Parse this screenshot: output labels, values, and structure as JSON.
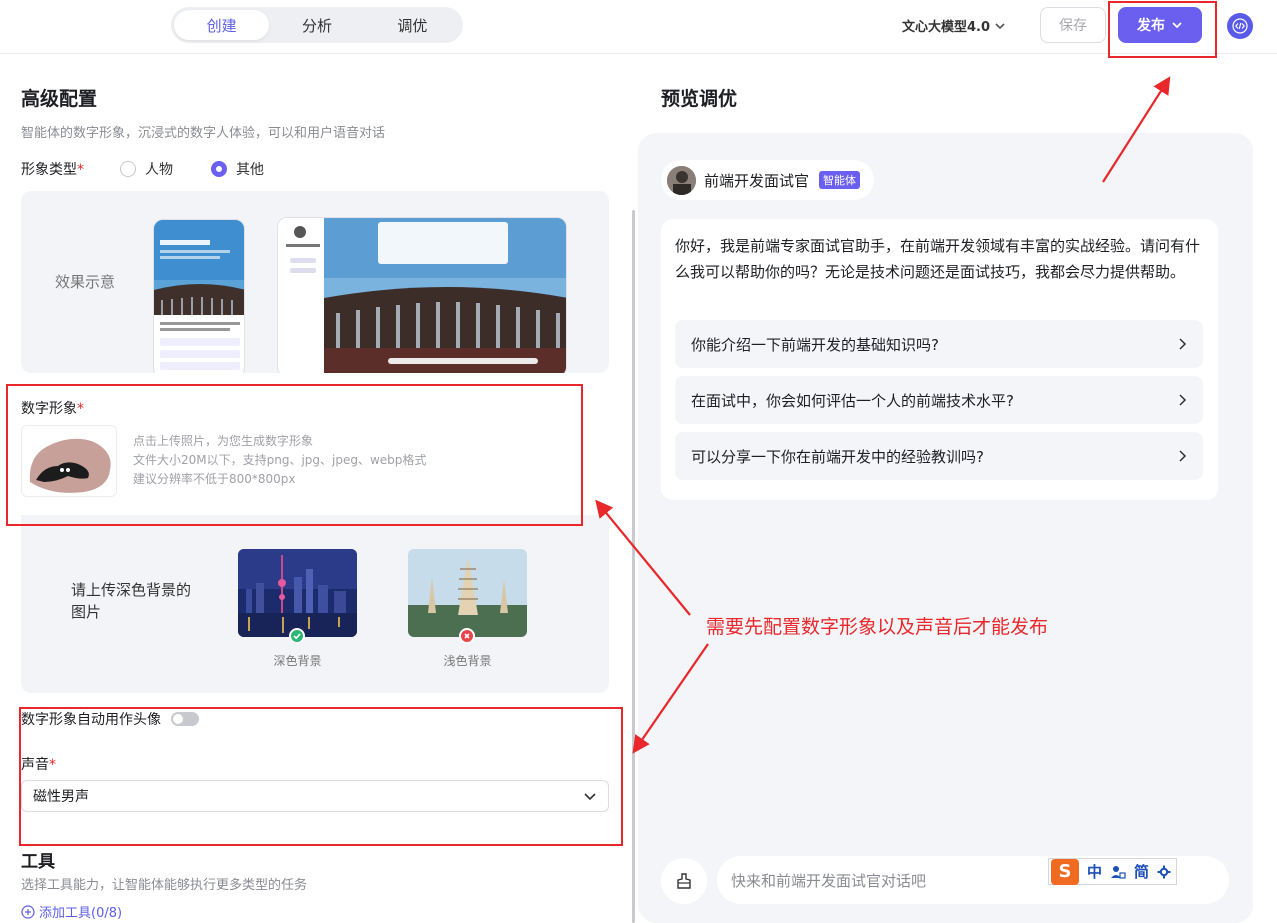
{
  "header": {
    "tabs": [
      {
        "label": "创建",
        "active": true
      },
      {
        "label": "分析",
        "active": false
      },
      {
        "label": "调优",
        "active": false
      }
    ],
    "model_label": "文心大模型4.0",
    "save_label": "保存",
    "publish_label": "发布"
  },
  "config": {
    "title": "高级配置",
    "subtitle": "智能体的数字形象，沉浸式的数字人体验，可以和用户语音对话",
    "type_label": "形象类型",
    "type_options": [
      {
        "label": "人物",
        "selected": false
      },
      {
        "label": "其他",
        "selected": true
      }
    ],
    "demo_label": "效果示意",
    "digital_label": "数字形象",
    "upload_tips": [
      "点击上传照片，为您生成数字形象",
      "文件大小20M以下，支持png、jpg、jpeg、webp格式",
      "建议分辨率不低于800*800px"
    ],
    "bg_hint": "请上传深色背景的图片",
    "bg_dark_caption": "深色背景",
    "bg_light_caption": "浅色背景",
    "auto_avatar_label": "数字形象自动用作头像",
    "auto_avatar_on": false,
    "voice_label": "声音",
    "voice_value": "磁性男声",
    "tools_title": "工具",
    "tools_subtitle": "选择工具能力，让智能体能够执行更多类型的任务",
    "add_tool_label": "添加工具(0/8)"
  },
  "preview": {
    "title": "预览调优",
    "agent_name": "前端开发面试官",
    "agent_tag": "智能体",
    "greeting": "你好，我是前端专家面试官助手，在前端开发领域有丰富的实战经验。请问有什么我可以帮助你的吗？无论是技术问题还是面试技巧，我都会尽力提供帮助。",
    "suggestions": [
      "你能介绍一下前端开发的基础知识吗?",
      "在面试中，你会如何评估一个人的前端技术水平?",
      "可以分享一下你在前端开发中的经验教训吗?"
    ],
    "input_placeholder": "快来和前端开发面试官对话吧"
  },
  "ime": {
    "logo": "S",
    "items": [
      "中",
      "简"
    ]
  },
  "annotation": {
    "text": "需要先配置数字形象以及声音后才能发布"
  },
  "colors": {
    "accent": "#6b5ff0",
    "annotation_red": "#e8282b"
  }
}
